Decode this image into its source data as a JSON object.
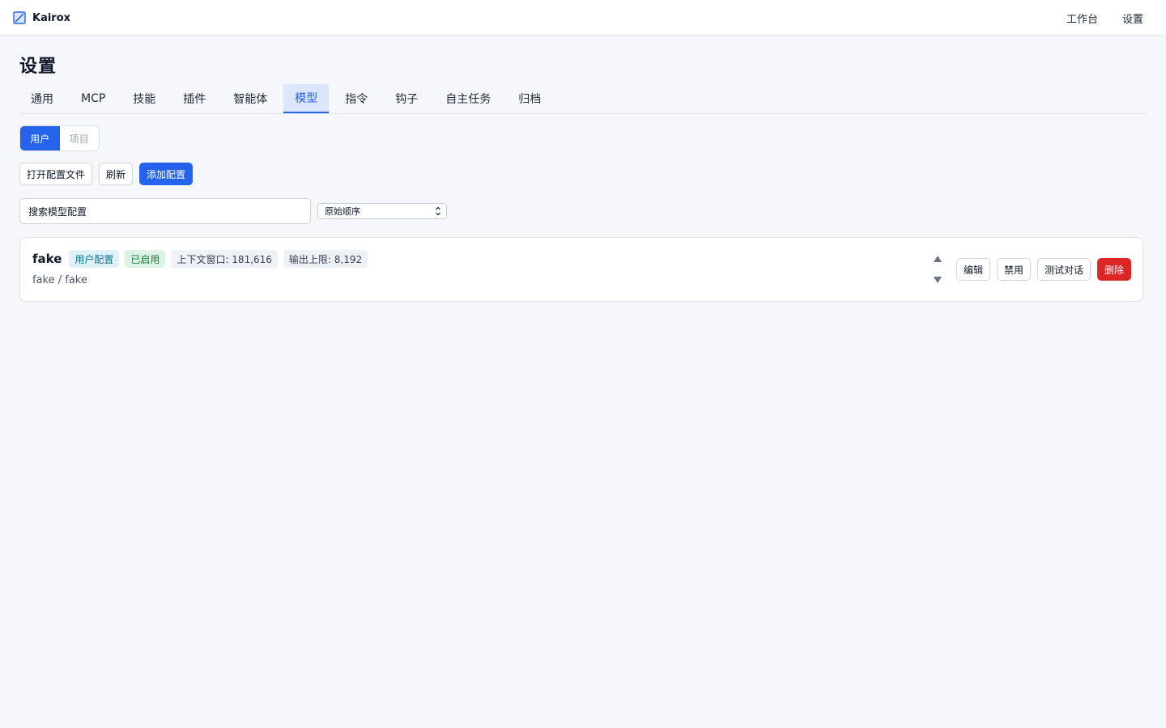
{
  "app": {
    "name": "Kairox",
    "logo_icon": "pen-square-icon",
    "nav": [
      "工作台",
      "设置"
    ]
  },
  "page": {
    "title": "设置"
  },
  "tabs": {
    "items": [
      "通用",
      "MCP",
      "技能",
      "插件",
      "智能体",
      "模型",
      "指令",
      "钩子",
      "自主任务",
      "归档"
    ],
    "active": "模型"
  },
  "scope": {
    "options": [
      "用户",
      "项目"
    ],
    "selected": "用户"
  },
  "actions": {
    "open_config": "打开配置文件",
    "refresh": "刷新",
    "add_config": "添加配置"
  },
  "search": {
    "value": "搜索模型配置",
    "placeholder": "搜索模型配置"
  },
  "sort": {
    "selected": "原始顺序"
  },
  "models": [
    {
      "name": "fake",
      "scope_badge": "用户配置",
      "status_badge": "已启用",
      "context_window": "上下文窗口: 181,616",
      "max_output": "输出上限: 8,192",
      "provider_model": "fake / fake",
      "move_up_icon": "triangle-up-icon",
      "move_down_icon": "triangle-down-icon",
      "edit_label": "编辑",
      "disable_label": "禁用",
      "test_label": "测试对话",
      "delete_label": "删除"
    }
  ],
  "colors": {
    "accent": "#2563eb",
    "danger": "#dc2626",
    "background": "#f5f7fb",
    "success_text": "#15803d"
  }
}
